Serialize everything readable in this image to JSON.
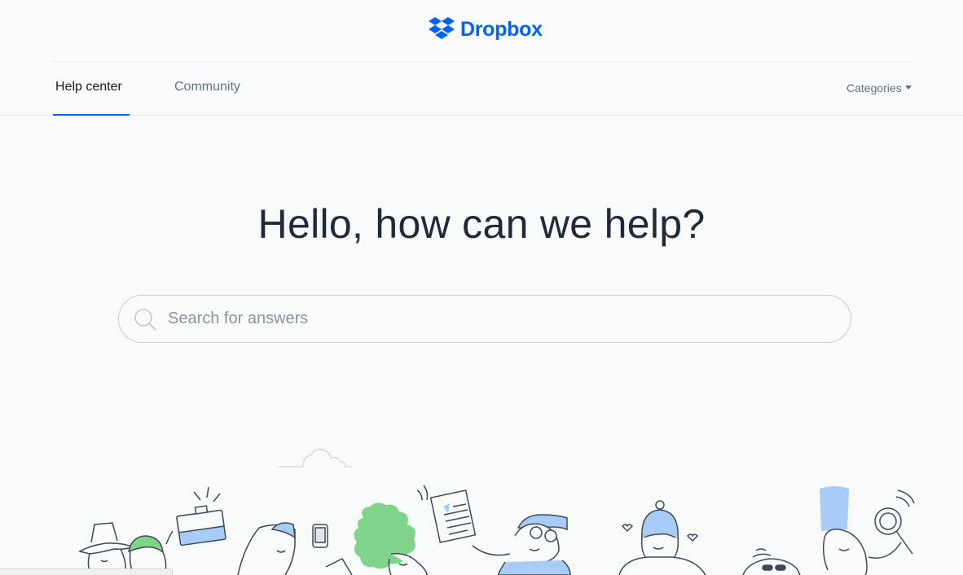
{
  "brand": {
    "name": "Dropbox",
    "color": "#0061fe",
    "icon": "dropbox-box-icon"
  },
  "nav": {
    "tabs": [
      {
        "label": "Help center",
        "active": true
      },
      {
        "label": "Community",
        "active": false
      }
    ],
    "categories_label": "Categories",
    "categories_icon": "caret-down-icon"
  },
  "hero": {
    "title": "Hello, how can we help?"
  },
  "search": {
    "placeholder": "Search for answers",
    "value": "",
    "icon": "search-icon"
  },
  "illustration": {
    "description_icon": "people-illustration",
    "accent_colors": {
      "blue": "#a9ccf7",
      "green": "#7fd48a"
    }
  }
}
